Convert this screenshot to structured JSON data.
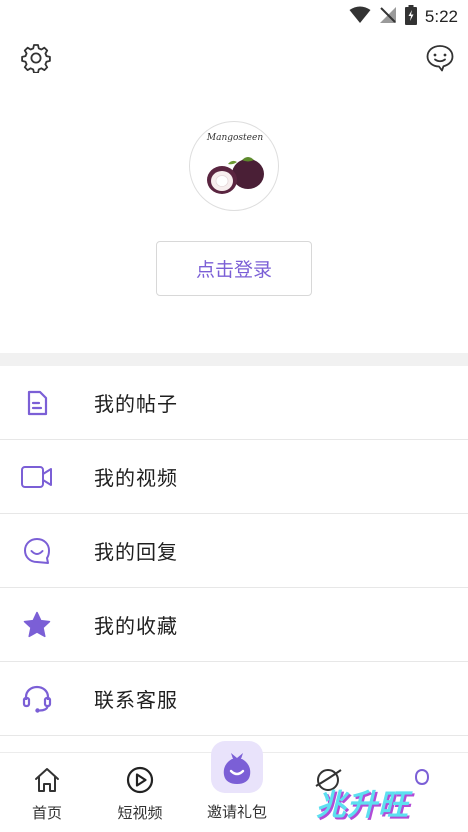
{
  "status_bar": {
    "time": "5:22",
    "icons": [
      "wifi-icon",
      "no-signal-icon",
      "battery-icon"
    ]
  },
  "header": {
    "settings_icon": "gear-icon",
    "message_icon": "chat-bubble-icon"
  },
  "profile": {
    "avatar_text": "Mangosteen",
    "login_label": "点击登录"
  },
  "menu": {
    "items": [
      {
        "label": "我的帖子",
        "icon": "document-icon"
      },
      {
        "label": "我的视频",
        "icon": "video-camera-icon"
      },
      {
        "label": "我的回复",
        "icon": "smile-bubble-icon"
      },
      {
        "label": "我的收藏",
        "icon": "star-icon"
      },
      {
        "label": "联系客服",
        "icon": "headset-icon"
      }
    ]
  },
  "tabbar": {
    "items": [
      {
        "label": "首页",
        "icon": "home-icon"
      },
      {
        "label": "短视频",
        "icon": "play-circle-icon"
      },
      {
        "label": "邀请礼包",
        "icon": "gift-bag-icon"
      },
      {
        "label": "",
        "icon": "planet-icon"
      },
      {
        "label": "",
        "icon": "person-icon"
      }
    ]
  },
  "watermark": {
    "text": "兆升旺"
  },
  "colors": {
    "accent": "#7b5fd6",
    "divider": "#f1f1f1",
    "watermark_fill": "#5de0f0",
    "watermark_shadow": "#b24bd6"
  }
}
